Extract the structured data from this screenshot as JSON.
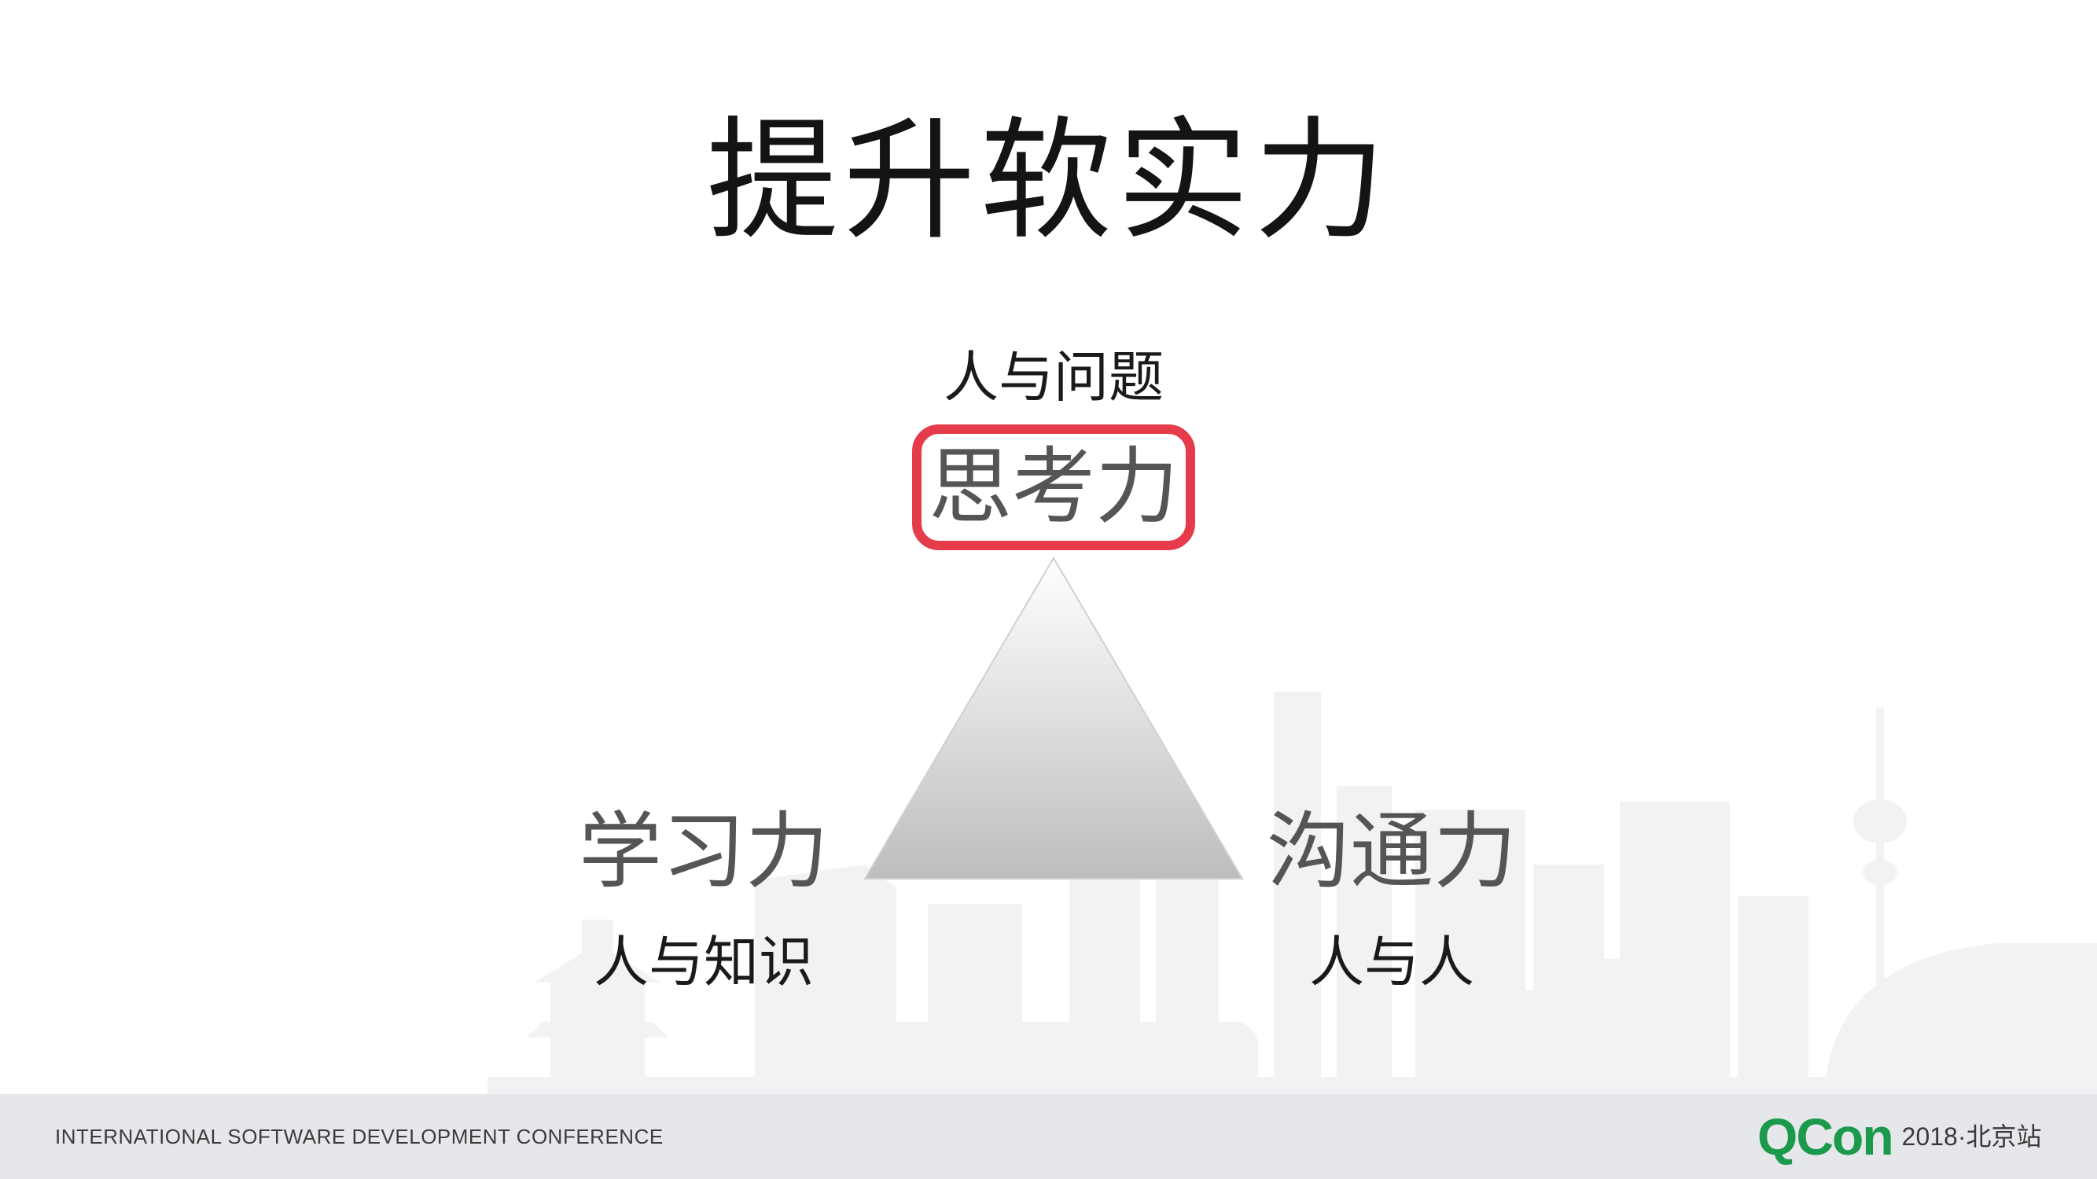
{
  "slide": {
    "title": "提升软实力",
    "top_caption": "人与问题",
    "top_node": "思考力",
    "left_node": "学习力",
    "left_caption": "人与知识",
    "right_node": "沟通力",
    "right_caption": "人与人",
    "highlight_color": "#e53b4a"
  },
  "footer": {
    "conference": "INTERNATIONAL SOFTWARE DEVELOPMENT CONFERENCE",
    "logo_text": "QCon",
    "edition": "2018·北京站",
    "logo_color": "#1c9a4c"
  }
}
